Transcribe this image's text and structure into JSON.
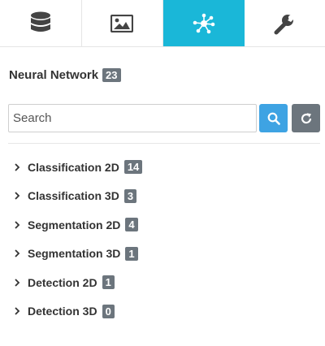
{
  "colors": {
    "active_tab_bg": "#1ab7d8",
    "icon_gray": "#444444",
    "search_button": "#3ea3e3",
    "refresh_button": "#6c757d",
    "badge": "#6c757d"
  },
  "tabs": [
    {
      "icon": "database-icon",
      "active": false
    },
    {
      "icon": "image-icon",
      "active": false
    },
    {
      "icon": "network-icon",
      "active": true
    },
    {
      "icon": "wrench-icon",
      "active": false
    }
  ],
  "header": {
    "title": "Neural Network",
    "count": "23"
  },
  "search": {
    "placeholder": "Search",
    "value": "",
    "search_button_icon": "search-icon",
    "refresh_button_icon": "refresh-icon"
  },
  "tree": {
    "items": [
      {
        "label": "Classification 2D",
        "count": "14"
      },
      {
        "label": "Classification 3D",
        "count": "3"
      },
      {
        "label": "Segmentation 2D",
        "count": "4"
      },
      {
        "label": "Segmentation 3D",
        "count": "1"
      },
      {
        "label": "Detection 2D",
        "count": "1"
      },
      {
        "label": "Detection 3D",
        "count": "0"
      }
    ]
  }
}
